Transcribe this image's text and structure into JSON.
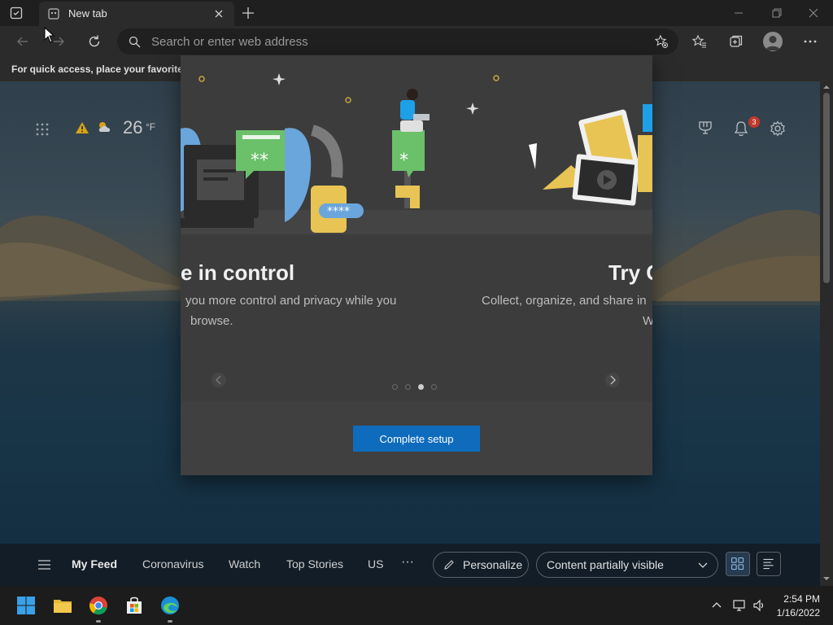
{
  "browser": {
    "tab_title": "New tab",
    "address_placeholder": "Search or enter web address",
    "favorites_bar_message": "For quick access, place your favorites h"
  },
  "ntp": {
    "temperature": "26",
    "temperature_unit": "°F",
    "notification_count": "3",
    "feed": {
      "tabs": [
        "My Feed",
        "Coronavirus",
        "Watch",
        "Top Stories",
        "US"
      ],
      "more": "···",
      "personalize_label": "Personalize",
      "content_visibility": "Content partially visible"
    }
  },
  "dialog": {
    "slide_left": {
      "title": "e in control",
      "desc_line1": "you more control and privacy while you",
      "desc_line2": "browse."
    },
    "slide_right": {
      "title": "Try C",
      "desc_line1": "Collect, organize, and share in",
      "desc_line2": "W"
    },
    "dots_total": 4,
    "dots_active_index": 2,
    "complete_button": "Complete setup",
    "password_mask": "****"
  },
  "taskbar": {
    "time": "2:54 PM",
    "date": "1/16/2022"
  },
  "icons": {
    "tab_actions": "tab-actions-icon",
    "back": "back-arrow-icon",
    "forward": "forward-arrow-icon",
    "refresh": "refresh-icon",
    "search": "search-icon",
    "add_favorite": "star-add-icon",
    "favorites": "favorites-icon",
    "collections": "collections-icon",
    "profile": "profile-icon",
    "more": "more-icon",
    "apps": "app-launcher-icon",
    "weather_alert": "warning-icon",
    "weather": "partly-cloudy-icon",
    "rewards": "rewards-icon",
    "notifications": "bell-icon",
    "settings": "gear-icon"
  },
  "colors": {
    "accent_button": "#0f6cbd",
    "dialog_bg": "#3c3c3c",
    "badge": "#c0392b"
  }
}
